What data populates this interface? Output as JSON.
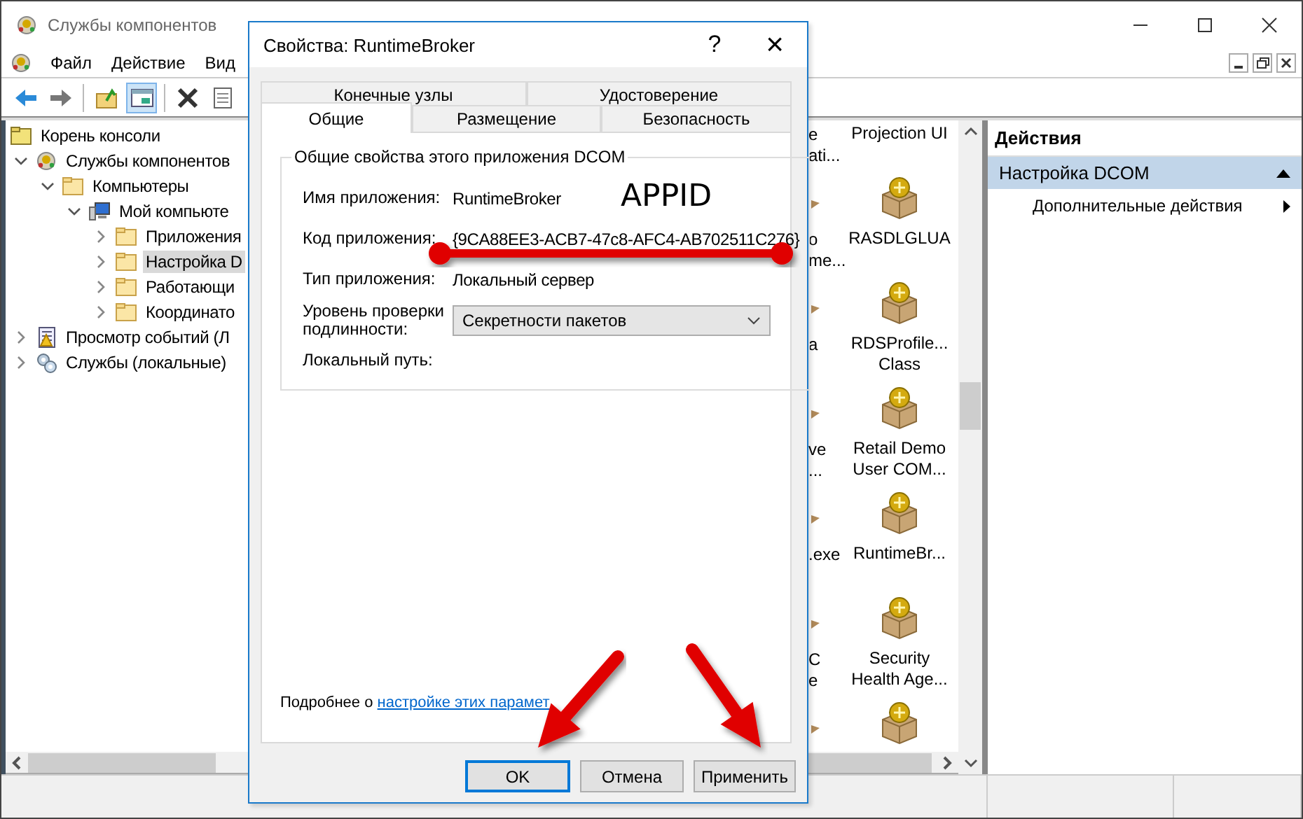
{
  "window": {
    "title": "Службы компонентов"
  },
  "menu": [
    {
      "label": "Файл"
    },
    {
      "label": "Действие"
    },
    {
      "label": "Вид"
    }
  ],
  "toolbar": [
    {
      "kind": "back",
      "pressed": false
    },
    {
      "kind": "forward",
      "pressed": false
    },
    {
      "kind": "separator"
    },
    {
      "kind": "up",
      "pressed": false
    },
    {
      "kind": "tree",
      "pressed": true
    },
    {
      "kind": "separator"
    },
    {
      "kind": "delete",
      "pressed": false
    },
    {
      "kind": "properties",
      "pressed": false
    }
  ],
  "tree": [
    {
      "label": "Корень консоли",
      "kind": "root",
      "selected": false,
      "children": [
        {
          "label": "Службы компонентов",
          "kind": "component",
          "expanded": true,
          "selected": false,
          "children": [
            {
              "label": "Компьютеры",
              "kind": "folder",
              "expanded": true,
              "selected": false,
              "children": [
                {
                  "label": "Мой компьюте",
                  "kind": "computer",
                  "expanded": true,
                  "selected": false,
                  "children": [
                    {
                      "label": "Приложения",
                      "kind": "folder",
                      "expanded": false,
                      "selected": false
                    },
                    {
                      "label": "Настройка D",
                      "kind": "folder",
                      "expanded": false,
                      "selected": true
                    },
                    {
                      "label": "Работающи",
                      "kind": "folder",
                      "expanded": false,
                      "selected": false
                    },
                    {
                      "label": "Координато",
                      "kind": "folder",
                      "expanded": false,
                      "selected": false
                    }
                  ]
                }
              ]
            }
          ]
        },
        {
          "label": "Просмотр событий (Л",
          "kind": "events",
          "expanded": false,
          "selected": false
        },
        {
          "label": "Службы (локальные)",
          "kind": "services",
          "expanded": false,
          "selected": false
        }
      ]
    }
  ],
  "icons_view": {
    "partial_column": [
      {
        "kind": "label-only",
        "lines": [
          "e",
          "ati..."
        ]
      },
      {
        "kind": "package",
        "lines": [
          "o",
          "me..."
        ]
      },
      {
        "kind": "package",
        "lines": [
          "a"
        ]
      },
      {
        "kind": "package",
        "lines": [
          "ve",
          "..."
        ]
      },
      {
        "kind": "package",
        "lines": [
          ".exe"
        ]
      },
      {
        "kind": "package",
        "lines": [
          "C",
          "e"
        ]
      },
      {
        "kind": "package"
      }
    ],
    "items": [
      {
        "kind": "label-only",
        "lines": [
          "Projection UI"
        ]
      },
      {
        "kind": "package",
        "lines": [
          "RASDLGLUA"
        ]
      },
      {
        "kind": "package",
        "lines": [
          "RDSProfile...",
          "Class"
        ]
      },
      {
        "kind": "package",
        "lines": [
          "Retail Demo",
          "User COM..."
        ]
      },
      {
        "kind": "package",
        "lines": [
          "RuntimeBr..."
        ]
      },
      {
        "kind": "package",
        "lines": [
          "Security",
          "Health Age..."
        ]
      },
      {
        "kind": "package"
      }
    ]
  },
  "actions": {
    "title": "Действия",
    "sections": [
      {
        "label": "Настройка DCOM",
        "expanded": true,
        "items": [
          {
            "label": "Дополнительные действия"
          }
        ]
      }
    ]
  },
  "dialog": {
    "title": "Свойства: RuntimeBroker",
    "help": "?",
    "close": "×",
    "tab_rows": [
      [
        {
          "label": "Конечные узлы",
          "selected": false
        },
        {
          "label": "Удостоверение",
          "selected": false
        }
      ],
      [
        {
          "label": "Общие",
          "selected": true
        },
        {
          "label": "Размещение",
          "selected": false
        },
        {
          "label": "Безопасность",
          "selected": false
        }
      ]
    ],
    "group_title": "Общие свойства этого приложения DCOM",
    "fields": [
      {
        "label": "Имя приложения:",
        "kind": "text",
        "value": "RuntimeBroker"
      },
      {
        "label": "Код приложения:",
        "kind": "text",
        "value": "{9CA88EE3-ACB7-47c8-AFC4-AB702511C276}"
      },
      {
        "label": "Тип приложения:",
        "kind": "text",
        "value": "Локальный сервер"
      },
      {
        "label": "Уровень проверки подлинности:",
        "kind": "dropdown",
        "value": "Секретности пакетов"
      },
      {
        "label": "Локальный путь:",
        "kind": "text"
      }
    ],
    "more_text": "Подробнее о ",
    "more_link": "настройке этих парамет",
    "buttons": [
      {
        "label": "OK",
        "default": true
      },
      {
        "label": "Отмена",
        "default": false
      },
      {
        "label": "Применить",
        "default": false
      }
    ]
  },
  "annotation": {
    "label": "APPID"
  }
}
